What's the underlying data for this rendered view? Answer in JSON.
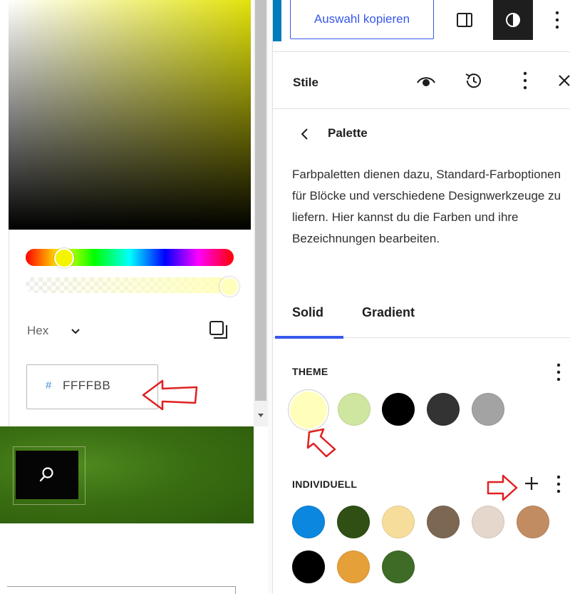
{
  "color_picker": {
    "color_space": "Hex",
    "hex_prefix": "#",
    "hex_value": "FFFFBB",
    "selected_color": "#ffffbb",
    "hue_color": "#f4f400"
  },
  "toolbar": {
    "copy_selection_label": "Auswahl kopieren",
    "accent": "#3858e9"
  },
  "panel": {
    "title": "Stile",
    "section_title": "Palette",
    "description": "Farbpaletten dienen dazu, Standard-Farboptionen für Blöcke und verschiedene Designwerkzeuge zu liefern. Hier kannst du die Farben und ihre Bezeichnungen bearbeiten.",
    "tabs": [
      {
        "label": "Solid",
        "active": true
      },
      {
        "label": "Gradient",
        "active": false
      }
    ],
    "theme": {
      "heading": "THEME",
      "swatches": [
        "#ffffbb",
        "#cfe6a0",
        "#000000",
        "#333333",
        "#a3a3a3"
      ]
    },
    "individual": {
      "heading": "INDIVIDUELL",
      "swatches": [
        "#0b87df",
        "#2f4f14",
        "#f7dd9b",
        "#7c6753",
        "#e5d7cb",
        "#c28c62",
        "#000000",
        "#e6a03a",
        "#3e6b26"
      ]
    }
  },
  "annotation_color": "#e02020"
}
